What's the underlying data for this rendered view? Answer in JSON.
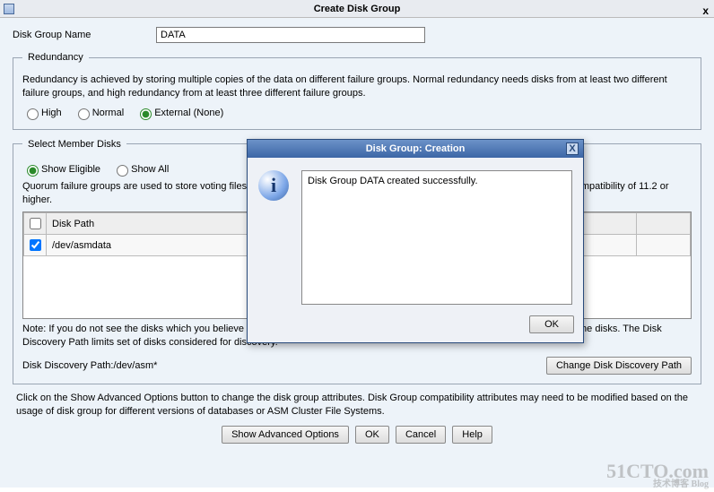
{
  "window": {
    "title": "Create Disk Group",
    "close_glyph": "x"
  },
  "form": {
    "disk_group_name_label": "Disk Group Name",
    "disk_group_name_value": "DATA"
  },
  "redundancy": {
    "legend": "Redundancy",
    "description": "Redundancy is achieved by storing multiple copies of the data on different failure groups. Normal redundancy needs disks from at least two different failure groups, and high redundancy from at least three different failure groups.",
    "options": {
      "high": "High",
      "normal": "Normal",
      "external": "External (None)"
    },
    "selected": "external"
  },
  "members": {
    "legend": "Select Member Disks",
    "show_eligible": "Show Eligible",
    "show_all": "Show All",
    "show_selected": "eligible",
    "quorum_note": "Quorum failure groups are used to store voting files in extended clusters and do not contain any user data. They require ASM compatibility of 11.2 or higher.",
    "columns": {
      "disk_path": "Disk Path"
    },
    "rows": [
      {
        "checked": true,
        "disk_path": "/dev/asmdata"
      }
    ],
    "note": "Note: If you do not see the disks which you believe are available, check the Disk Discovery Path and read/write permissions on the disks. The Disk Discovery Path limits set of disks considered for discovery.",
    "discovery_path_label": "Disk Discovery Path:",
    "discovery_path_value": "/dev/asm*",
    "change_btn": "Change Disk Discovery Path"
  },
  "footer": {
    "compat_note": "Click on the Show Advanced Options button to change the disk group attributes. Disk Group compatibility attributes may need to be modified based on the usage of disk group for different versions of databases or ASM Cluster File Systems.",
    "buttons": {
      "advanced": "Show Advanced Options",
      "ok": "OK",
      "cancel": "Cancel",
      "help": "Help"
    }
  },
  "modal": {
    "title": "Disk Group: Creation",
    "message": "Disk Group DATA created successfully.",
    "ok": "OK"
  },
  "watermark": {
    "main": "51CTO.com",
    "sub": "技术博客  Blog"
  }
}
